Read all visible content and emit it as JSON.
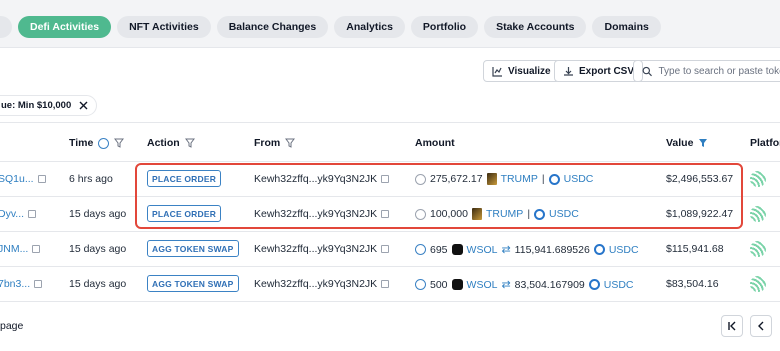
{
  "tabs": [
    "",
    "Defi Activities",
    "NFT Activities",
    "Balance Changes",
    "Analytics",
    "Portfolio",
    "Stake Accounts",
    "Domains"
  ],
  "active_tab": 1,
  "toolbar": {
    "visualize_label": "Visualize",
    "export_label": "Export CSV"
  },
  "search": {
    "placeholder": "Type to search or paste token address"
  },
  "filter_chip": {
    "label": "ue: Min $10,000"
  },
  "columns": {
    "time": "Time",
    "action": "Action",
    "from": "From",
    "amount": "Amount",
    "value": "Value",
    "platform": "Platfor"
  },
  "rows": [
    {
      "sig": "SQ1u...",
      "time": "6 hrs ago",
      "action": "PLACE ORDER",
      "from": "Kewh32zffq...yk9Yq3N2JK",
      "amount_a": "275,672.17",
      "token_a": "TRUMP",
      "sep": "|",
      "token_b": "USDC",
      "value": "$2,496,553.67"
    },
    {
      "sig": "Dyv...",
      "time": "15 days ago",
      "action": "PLACE ORDER",
      "from": "Kewh32zffq...yk9Yq3N2JK",
      "amount_a": "100,000",
      "token_a": "TRUMP",
      "sep": "|",
      "token_b": "USDC",
      "value": "$1,089,922.47"
    },
    {
      "sig": "JNM...",
      "time": "15 days ago",
      "action": "AGG TOKEN SWAP",
      "from": "Kewh32zffq...yk9Yq3N2JK",
      "amount_a": "695",
      "token_a": "WSOL",
      "amount_b": "115,941.689526",
      "token_b": "USDC",
      "value": "$115,941.68"
    },
    {
      "sig": "7bn3...",
      "time": "15 days ago",
      "action": "AGG TOKEN SWAP",
      "from": "Kewh32zffq...yk9Yq3N2JK",
      "amount_a": "500",
      "token_a": "WSOL",
      "amount_b": "83,504.167909",
      "token_b": "USDC",
      "value": "$83,504.16"
    }
  ],
  "footer": {
    "text": "page"
  },
  "icons": {
    "clock": "clock-icon",
    "filter": "funnel-icon",
    "copy": "copy-icon",
    "swap": "swap-arrows-icon"
  },
  "colors": {
    "accent": "#4fb98f",
    "link": "#2f7fc1",
    "highlight": "#e2473a"
  }
}
